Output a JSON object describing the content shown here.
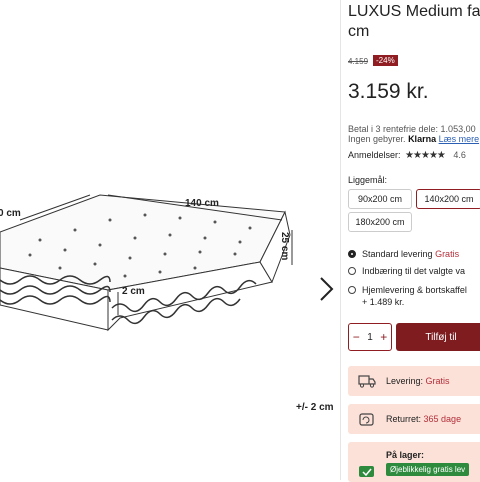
{
  "gallery": {
    "dim_width": "140 cm",
    "dim_length": "0 cm",
    "dim_height": "25 cm",
    "dim_topper": "2 cm",
    "tolerance": "+/- 2 cm"
  },
  "product": {
    "title_line1": "LUXUS Medium fas",
    "title_line2": "cm",
    "old_price": "4.159",
    "discount": "-24%",
    "price": "3.159 kr.",
    "installment": "Betal i 3 rentefrie dele: 1.053,00",
    "fees_text": "Ingen gebyrer.",
    "klarna": "Klarna",
    "read_more": "Læs mere",
    "reviews_label": "Anmeldelser:",
    "stars": "★★★★★",
    "rating": "4.6"
  },
  "sizes": {
    "label": "Liggemål:",
    "options": [
      "90x200 cm",
      "140x200 cm",
      "180x200 cm"
    ],
    "selected": "140x200 cm"
  },
  "delivery": {
    "opt1": "Standard levering",
    "opt1_price": "Gratis",
    "opt2": "Indbæring til det valgte va",
    "opt3": "Hjemlevering & bortskaffel",
    "opt3_price": "+ 1.489 kr."
  },
  "cart": {
    "minus": "−",
    "qty": "1",
    "plus": "+",
    "add_label": "Tilføj til"
  },
  "info": {
    "shipping_label": "Levering:",
    "shipping_value": "Gratis",
    "returns_label": "Returret:",
    "returns_value": "365 dage",
    "stock_label": "På lager:",
    "stock_button": "Øjeblikkelig gratis lev"
  },
  "colors": {
    "brand": "#8f1d22",
    "info_bg": "#fbe1d8",
    "stock_green": "#2e8b3e"
  }
}
